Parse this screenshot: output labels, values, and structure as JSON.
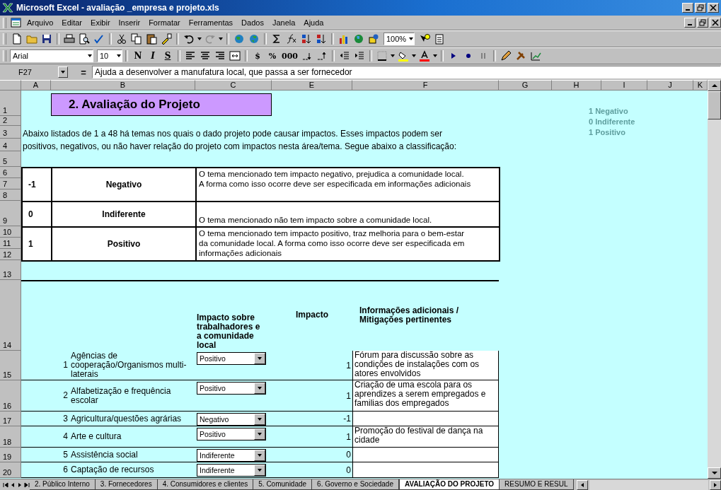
{
  "window": {
    "title": "Microsoft Excel - avaliação _empresa e projeto.xls"
  },
  "menu": [
    "Arquivo",
    "Editar",
    "Exibir",
    "Inserir",
    "Formatar",
    "Ferramentas",
    "Dados",
    "Janela",
    "Ajuda"
  ],
  "toolbar": {
    "zoom": "100%"
  },
  "format_bar": {
    "font": "Arial",
    "size": "10",
    "style_buttons": [
      "N",
      "I",
      "S"
    ],
    "number_buttons": [
      "$",
      "%",
      "000"
    ]
  },
  "formula_bar": {
    "name_box": "F27",
    "equals": "=",
    "content": "Ajuda a desenvolver a manufatura local, que passa a ser fornecedor"
  },
  "columns": [
    "A",
    "B",
    "C",
    "E",
    "F",
    "G",
    "H",
    "I",
    "J",
    "K"
  ],
  "rows": [
    "1",
    "2",
    "3",
    "4",
    "5",
    "6",
    "7",
    "8",
    "9",
    "10",
    "11",
    "12",
    "13",
    "14",
    "15",
    "16",
    "17",
    "18",
    "19",
    "20"
  ],
  "sheet": {
    "title": "2. Avaliação do Projeto",
    "intro": [
      "Abaixo listados de 1 a 48 há temas nos quais o dado projeto pode causar impactos. Esses impactos podem ser",
      "positivos, negativos, ou não haver relação do projeto com impactos nesta área/tema. Segue abaixo a classificação:"
    ],
    "side_legend": [
      "1 Negativo",
      "0 Indiferente",
      "1 Positivo"
    ],
    "legend": [
      {
        "value": "-1",
        "label": "Negativo",
        "lines": [
          "O tema mencionado tem impacto negativo, prejudica a comunidade local.",
          "A forma como isso ocorre deve ser especificada em informações adicionais"
        ]
      },
      {
        "value": "0",
        "label": "Indiferente",
        "lines": [
          "O tema mencionado não tem impacto sobre a comunidade local."
        ]
      },
      {
        "value": "1",
        "label": "Positivo",
        "lines": [
          "O tema mencionado tem impacto positivo, traz melhoria para o bem-estar",
          "da comunidade local. A forma como isso ocorre deve ser especificada em",
          "informações adicionais"
        ]
      }
    ],
    "table": {
      "headers": [
        "Impacto sobre trabalhadores e a comunidade local",
        "Impacto",
        "Informações adicionais / Mitigações pertinentes"
      ],
      "rows": [
        {
          "number": "1",
          "theme": "Agências de cooperação/Organismos multi-laterais",
          "choice": "Positivo",
          "impact": "1",
          "info": "Fórum para discussão sobre as condições de instalações com os atores envolvidos"
        },
        {
          "number": "2",
          "theme": "Alfabetização e frequência escolar",
          "choice": "Positivo",
          "impact": "1",
          "info": "Criação de uma escola para os aprendizes a serem empregados e familias dos empregados"
        },
        {
          "number": "3",
          "theme": "Agricultura/questões agrárias",
          "choice": "Negativo",
          "impact": "-1",
          "info": ""
        },
        {
          "number": "4",
          "theme": "Arte e cultura",
          "choice": "Positivo",
          "impact": "1",
          "info": "Promoção do festival de dança na cidade"
        },
        {
          "number": "5",
          "theme": "Assistência social",
          "choice": "Indiferente",
          "impact": "0",
          "info": ""
        },
        {
          "number": "6",
          "theme": "Captação de recursos",
          "choice": "Indiferente",
          "impact": "0",
          "info": ""
        }
      ]
    }
  },
  "sheet_tabs": [
    {
      "label": "2. Público Interno",
      "selected": false
    },
    {
      "label": "3. Fornecedores",
      "selected": false
    },
    {
      "label": "4. Consumidores e clientes",
      "selected": false
    },
    {
      "label": "5. Comunidade",
      "selected": false
    },
    {
      "label": "6. Governo e Sociedade",
      "selected": false
    },
    {
      "label": "AVALIAÇÃO DO PROJETO",
      "selected": true
    },
    {
      "label": "RESUMO E RESUL",
      "selected": false
    }
  ]
}
